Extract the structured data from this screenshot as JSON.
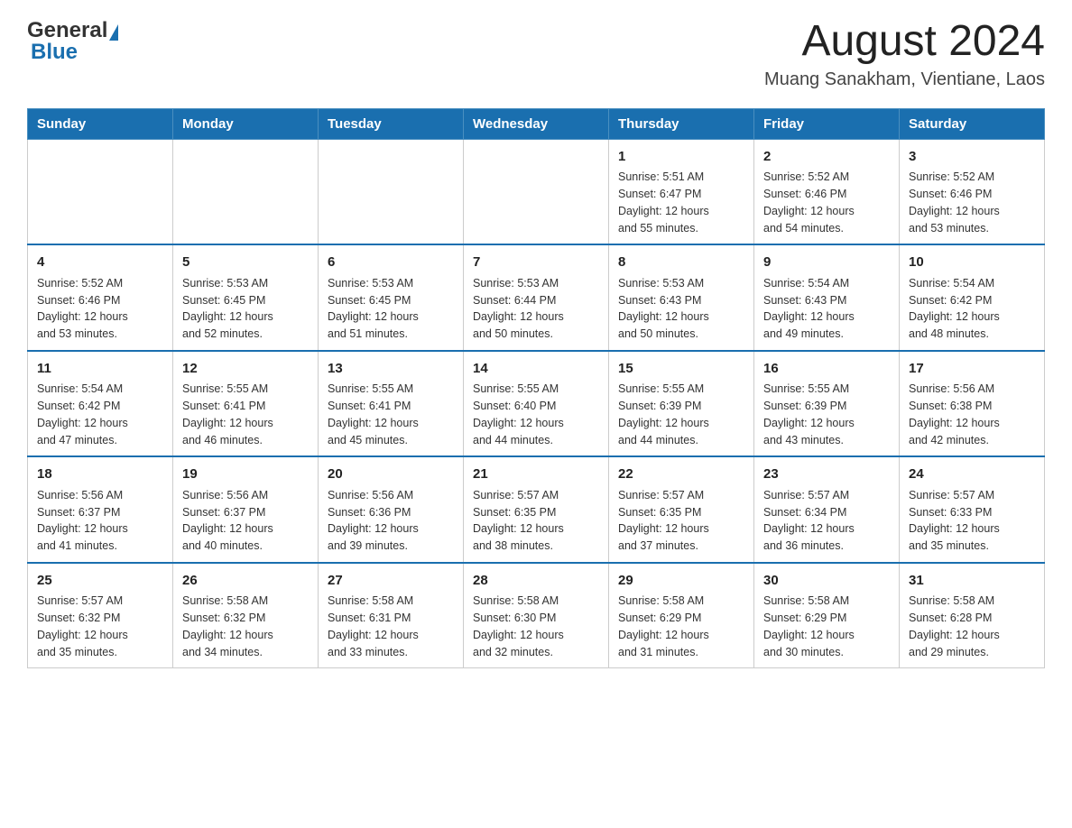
{
  "header": {
    "logo_general": "General",
    "logo_blue": "Blue",
    "title": "August 2024",
    "subtitle": "Muang Sanakham, Vientiane, Laos"
  },
  "weekdays": [
    "Sunday",
    "Monday",
    "Tuesday",
    "Wednesday",
    "Thursday",
    "Friday",
    "Saturday"
  ],
  "weeks": [
    [
      {
        "day": "",
        "info": ""
      },
      {
        "day": "",
        "info": ""
      },
      {
        "day": "",
        "info": ""
      },
      {
        "day": "",
        "info": ""
      },
      {
        "day": "1",
        "info": "Sunrise: 5:51 AM\nSunset: 6:47 PM\nDaylight: 12 hours\nand 55 minutes."
      },
      {
        "day": "2",
        "info": "Sunrise: 5:52 AM\nSunset: 6:46 PM\nDaylight: 12 hours\nand 54 minutes."
      },
      {
        "day": "3",
        "info": "Sunrise: 5:52 AM\nSunset: 6:46 PM\nDaylight: 12 hours\nand 53 minutes."
      }
    ],
    [
      {
        "day": "4",
        "info": "Sunrise: 5:52 AM\nSunset: 6:46 PM\nDaylight: 12 hours\nand 53 minutes."
      },
      {
        "day": "5",
        "info": "Sunrise: 5:53 AM\nSunset: 6:45 PM\nDaylight: 12 hours\nand 52 minutes."
      },
      {
        "day": "6",
        "info": "Sunrise: 5:53 AM\nSunset: 6:45 PM\nDaylight: 12 hours\nand 51 minutes."
      },
      {
        "day": "7",
        "info": "Sunrise: 5:53 AM\nSunset: 6:44 PM\nDaylight: 12 hours\nand 50 minutes."
      },
      {
        "day": "8",
        "info": "Sunrise: 5:53 AM\nSunset: 6:43 PM\nDaylight: 12 hours\nand 50 minutes."
      },
      {
        "day": "9",
        "info": "Sunrise: 5:54 AM\nSunset: 6:43 PM\nDaylight: 12 hours\nand 49 minutes."
      },
      {
        "day": "10",
        "info": "Sunrise: 5:54 AM\nSunset: 6:42 PM\nDaylight: 12 hours\nand 48 minutes."
      }
    ],
    [
      {
        "day": "11",
        "info": "Sunrise: 5:54 AM\nSunset: 6:42 PM\nDaylight: 12 hours\nand 47 minutes."
      },
      {
        "day": "12",
        "info": "Sunrise: 5:55 AM\nSunset: 6:41 PM\nDaylight: 12 hours\nand 46 minutes."
      },
      {
        "day": "13",
        "info": "Sunrise: 5:55 AM\nSunset: 6:41 PM\nDaylight: 12 hours\nand 45 minutes."
      },
      {
        "day": "14",
        "info": "Sunrise: 5:55 AM\nSunset: 6:40 PM\nDaylight: 12 hours\nand 44 minutes."
      },
      {
        "day": "15",
        "info": "Sunrise: 5:55 AM\nSunset: 6:39 PM\nDaylight: 12 hours\nand 44 minutes."
      },
      {
        "day": "16",
        "info": "Sunrise: 5:55 AM\nSunset: 6:39 PM\nDaylight: 12 hours\nand 43 minutes."
      },
      {
        "day": "17",
        "info": "Sunrise: 5:56 AM\nSunset: 6:38 PM\nDaylight: 12 hours\nand 42 minutes."
      }
    ],
    [
      {
        "day": "18",
        "info": "Sunrise: 5:56 AM\nSunset: 6:37 PM\nDaylight: 12 hours\nand 41 minutes."
      },
      {
        "day": "19",
        "info": "Sunrise: 5:56 AM\nSunset: 6:37 PM\nDaylight: 12 hours\nand 40 minutes."
      },
      {
        "day": "20",
        "info": "Sunrise: 5:56 AM\nSunset: 6:36 PM\nDaylight: 12 hours\nand 39 minutes."
      },
      {
        "day": "21",
        "info": "Sunrise: 5:57 AM\nSunset: 6:35 PM\nDaylight: 12 hours\nand 38 minutes."
      },
      {
        "day": "22",
        "info": "Sunrise: 5:57 AM\nSunset: 6:35 PM\nDaylight: 12 hours\nand 37 minutes."
      },
      {
        "day": "23",
        "info": "Sunrise: 5:57 AM\nSunset: 6:34 PM\nDaylight: 12 hours\nand 36 minutes."
      },
      {
        "day": "24",
        "info": "Sunrise: 5:57 AM\nSunset: 6:33 PM\nDaylight: 12 hours\nand 35 minutes."
      }
    ],
    [
      {
        "day": "25",
        "info": "Sunrise: 5:57 AM\nSunset: 6:32 PM\nDaylight: 12 hours\nand 35 minutes."
      },
      {
        "day": "26",
        "info": "Sunrise: 5:58 AM\nSunset: 6:32 PM\nDaylight: 12 hours\nand 34 minutes."
      },
      {
        "day": "27",
        "info": "Sunrise: 5:58 AM\nSunset: 6:31 PM\nDaylight: 12 hours\nand 33 minutes."
      },
      {
        "day": "28",
        "info": "Sunrise: 5:58 AM\nSunset: 6:30 PM\nDaylight: 12 hours\nand 32 minutes."
      },
      {
        "day": "29",
        "info": "Sunrise: 5:58 AM\nSunset: 6:29 PM\nDaylight: 12 hours\nand 31 minutes."
      },
      {
        "day": "30",
        "info": "Sunrise: 5:58 AM\nSunset: 6:29 PM\nDaylight: 12 hours\nand 30 minutes."
      },
      {
        "day": "31",
        "info": "Sunrise: 5:58 AM\nSunset: 6:28 PM\nDaylight: 12 hours\nand 29 minutes."
      }
    ]
  ]
}
